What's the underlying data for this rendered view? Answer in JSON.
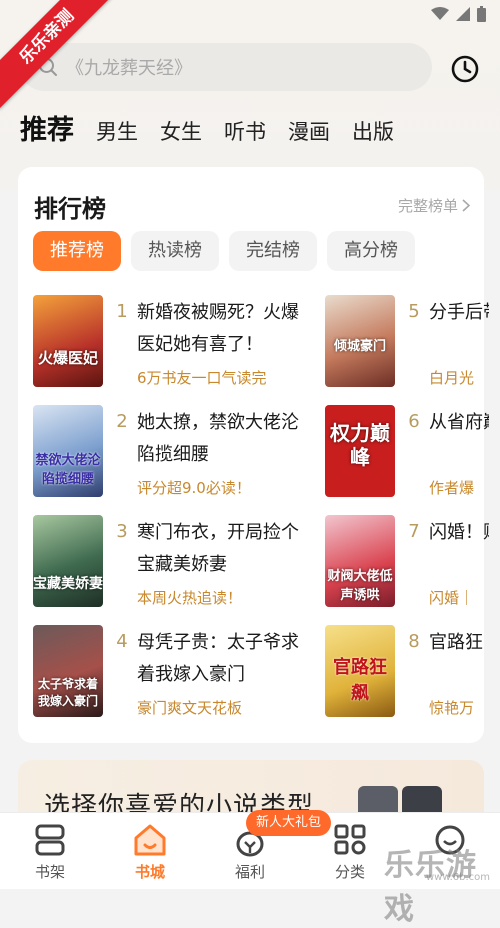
{
  "watermark": {
    "corner": "乐乐亲测",
    "brand": "乐乐游戏",
    "url": "www.6b.com"
  },
  "search": {
    "placeholder": "《九龙葬天经》"
  },
  "categories": [
    "推荐",
    "男生",
    "女生",
    "听书",
    "漫画",
    "出版"
  ],
  "ranking": {
    "title": "排行榜",
    "more": "完整榜单",
    "tabs": [
      "推荐榜",
      "热读榜",
      "完结榜",
      "高分榜"
    ],
    "books": [
      {
        "rank": "1",
        "title": "新婚夜被赐死？火爆医妃她有喜了！",
        "sub": "6万书友一口气读完",
        "cover_text": "火爆医妃"
      },
      {
        "rank": "2",
        "title": "她太撩，禁欲大佬沦陷揽细腰",
        "sub": "评分超9.0必读！",
        "cover_text": "禁欲大佬沦陷揽细腰"
      },
      {
        "rank": "3",
        "title": "寒门布衣，开局捡个宝藏美娇妻",
        "sub": "本周火热追读！",
        "cover_text": "宝藏美娇妻"
      },
      {
        "rank": "4",
        "title": "母凭子贵：太子爷求着我嫁入豪门",
        "sub": "豪门爽文天花板",
        "cover_text": "太子爷求着我嫁入豪门"
      },
      {
        "rank": "5",
        "title": "分手后带血孕",
        "sub": "白月光",
        "cover_text": "倾城豪门"
      },
      {
        "rank": "6",
        "title": "从省府巅峰",
        "sub": "作者爆",
        "cover_text": "权力巅峰"
      },
      {
        "rank": "7",
        "title": "闪婚！财阀大",
        "sub": "闪婚｜",
        "cover_text": "财阀大佬低声诱哄"
      },
      {
        "rank": "8",
        "title": "官路狂",
        "sub": "惊艳万",
        "cover_text": "官路狂飙"
      }
    ]
  },
  "banner": {
    "text": "选择你喜爱的小说类型"
  },
  "nav": {
    "items": [
      "书架",
      "书城",
      "福利",
      "分类",
      ""
    ],
    "gift_badge": "新人大礼包"
  },
  "colors": {
    "accent": "#ff7a2a",
    "sub": "#c8892e",
    "rank_num": "#b89b5e"
  }
}
